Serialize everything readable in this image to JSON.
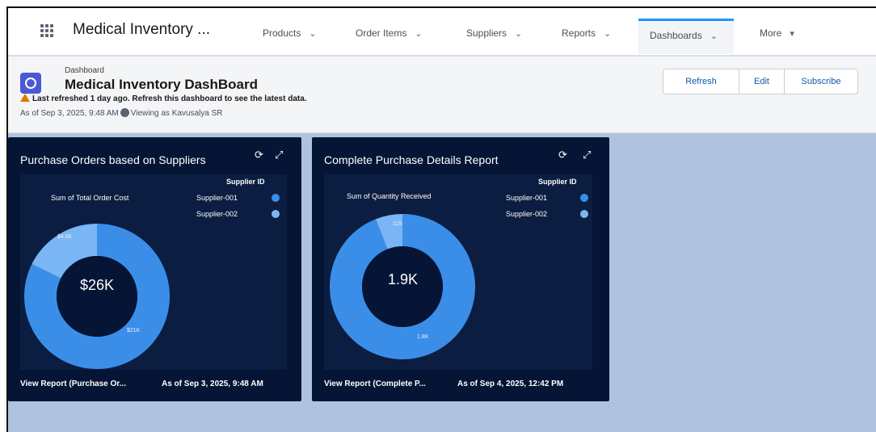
{
  "nav": {
    "app_name": "Medical Inventory ...",
    "items": [
      {
        "label": "Products",
        "chevron": "⌄"
      },
      {
        "label": "Order Items",
        "chevron": "⌄"
      },
      {
        "label": "Suppliers",
        "chevron": "⌄"
      },
      {
        "label": "Reports",
        "chevron": "⌄"
      },
      {
        "label": "Dashboards",
        "chevron": "⌄",
        "active": true
      },
      {
        "label": "More",
        "chevron": "▾"
      }
    ]
  },
  "header": {
    "breadcrumb": "Dashboard",
    "title": "Medical Inventory DashBoard",
    "refresh_notice": "Last refreshed 1 day ago. Refresh this dashboard to see the latest data.",
    "as_of": "As of Sep 3, 2025, 9:48 AM",
    "viewing_as": "Viewing as Kavusalya SR",
    "buttons": {
      "refresh": "Refresh",
      "edit": "Edit",
      "subscribe": "Subscribe"
    }
  },
  "colors": {
    "accent": "#1b96ff",
    "card_bg": "#061535",
    "supplier_001": "#3b8ee8",
    "supplier_002": "#7ab6f5",
    "warning": "#dd7a01"
  },
  "cards": [
    {
      "title": "Purchase Orders based on Suppliers",
      "metric_label": "Sum of Total Order Cost",
      "legend_title": "Supplier ID",
      "legend": [
        "Supplier-001",
        "Supplier-002"
      ],
      "center_value": "$26K",
      "slice_labels": [
        "$4.5K",
        "$21K"
      ],
      "footer_link": "View Report (Purchase Or...",
      "footer_time": "As of Sep 3, 2025, 9:48 AM"
    },
    {
      "title": "Complete Purchase Details Report",
      "metric_label": "Sum of Quantity Received",
      "legend_title": "Supplier ID",
      "legend": [
        "Supplier-001",
        "Supplier-002"
      ],
      "center_value": "1.9K",
      "slice_labels": [
        "115",
        "1.8K"
      ],
      "footer_link": "View Report (Complete P...",
      "footer_time": "As of Sep 4, 2025, 12:42 PM"
    }
  ],
  "chart_data": [
    {
      "type": "pie",
      "title": "Purchase Orders based on Suppliers",
      "metric": "Sum of Total Order Cost",
      "categories": [
        "Supplier-001",
        "Supplier-002"
      ],
      "values": [
        21000,
        4500
      ],
      "total": 26000,
      "legend": "right"
    },
    {
      "type": "pie",
      "title": "Complete Purchase Details Report",
      "metric": "Sum of Quantity Received",
      "categories": [
        "Supplier-001",
        "Supplier-002"
      ],
      "values": [
        1800,
        115
      ],
      "total": 1900,
      "legend": "right"
    }
  ]
}
